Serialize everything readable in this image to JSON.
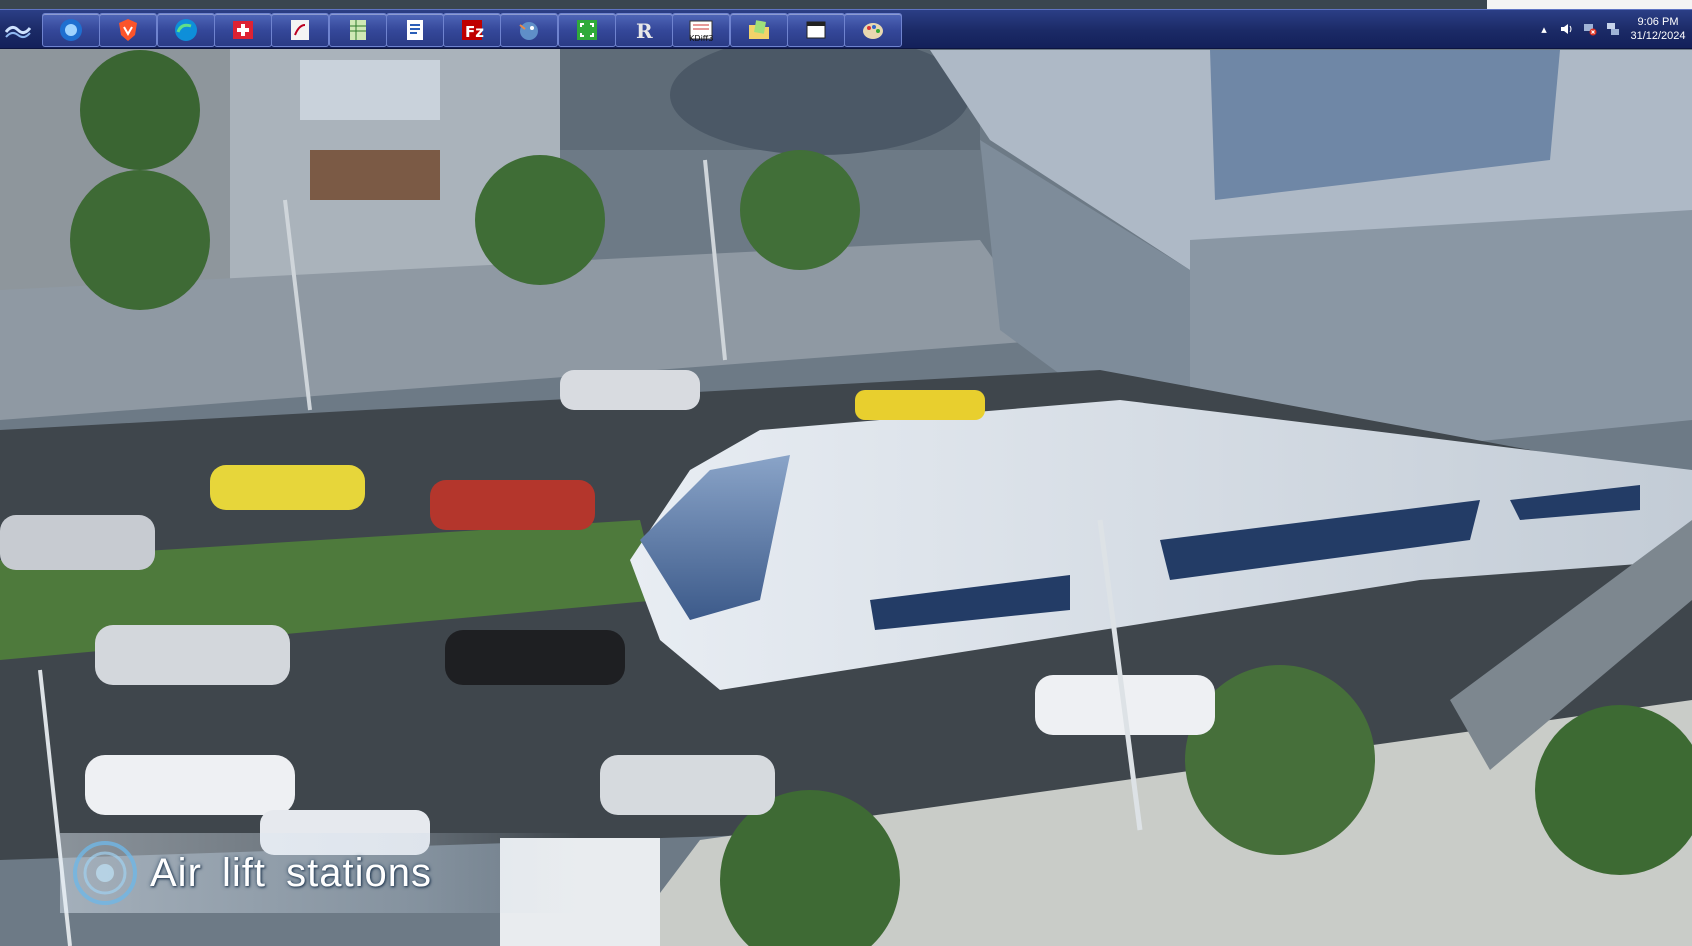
{
  "taskbar": {
    "apps": [
      {
        "name": "app-1-icon"
      },
      {
        "name": "brave-browser-icon"
      },
      {
        "name": "edge-browser-icon"
      },
      {
        "name": "red-cross-app-icon"
      },
      {
        "name": "swan-app-icon"
      },
      {
        "name": "spreadsheet-icon"
      },
      {
        "name": "document-icon"
      },
      {
        "name": "filezilla-icon"
      },
      {
        "name": "bird-app-icon"
      },
      {
        "name": "screenshot-app-icon"
      },
      {
        "name": "r-app-icon"
      },
      {
        "name": "kdiff3-icon",
        "label": "KDiff3"
      },
      {
        "name": "folder-notes-icon"
      },
      {
        "name": "window-icon"
      },
      {
        "name": "paint-palette-icon"
      }
    ],
    "clock": {
      "time": "9:06 PM",
      "date": "31/12/2024"
    }
  },
  "caption": {
    "text": "Air lift stations"
  },
  "colors": {
    "taskbar": "#1b2a66",
    "accent": "#6f83cf"
  }
}
